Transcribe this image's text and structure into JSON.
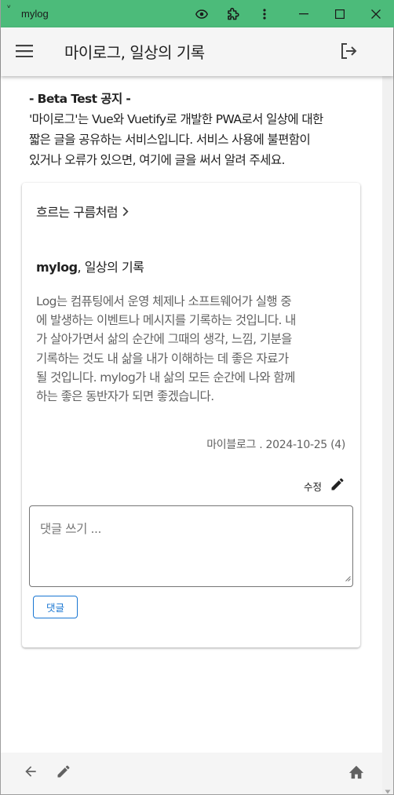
{
  "window": {
    "app_glyph": "ᵛ",
    "title": "mylog",
    "accent": "#4cbb7a",
    "buttons": [
      "eye-icon",
      "extension-icon",
      "more-vert-icon",
      "minimize-icon",
      "maximize-icon",
      "close-icon"
    ]
  },
  "appbar": {
    "title": "마이로그, 일상의 기록",
    "menu_icon": "menu-icon",
    "logout_icon": "logout-icon"
  },
  "notice": {
    "title": "- Beta Test 공지 -",
    "line1": "'마이로그'는 Vue와 Vuetify로 개발한 PWA로서 일상에 대한",
    "line2": "짧은 글을 공유하는 서비스입니다. 서비스 사용에 불편함이",
    "line3": "있거나 오류가 있으면, 여기에 글을 써서 알려 주세요."
  },
  "post": {
    "category": "흐르는 구름처럼",
    "title_bold": "mylog",
    "title_rest": ", 일상의 기록",
    "body_lines": [
      "Log는 컴퓨팅에서 운영 체제나 소프트웨어가 실행 중",
      "에 발생하는 이벤트나 메시지를 기록하는 것입니다. 내",
      "가 살아가면서 삶의 순간에 그때의 생각, 느낌, 기분을",
      "기록하는 것도 내 삶을 내가 이해하는 데 좋은 자료가",
      "될 것입니다. mylog가 내 삶의 모든 순간에 나와 함께",
      "하는 좋은 동반자가 되면 좋겠습니다."
    ],
    "meta": "마이블로그 . 2024-10-25 (4)",
    "edit_label": "수정"
  },
  "comment": {
    "placeholder": "댓글 쓰기 ...",
    "value": "",
    "button_label": "댓글",
    "button_color": "#1976d2"
  },
  "bottombar": {
    "icons": [
      "arrow-back-icon",
      "pencil-icon",
      "home-icon"
    ]
  }
}
